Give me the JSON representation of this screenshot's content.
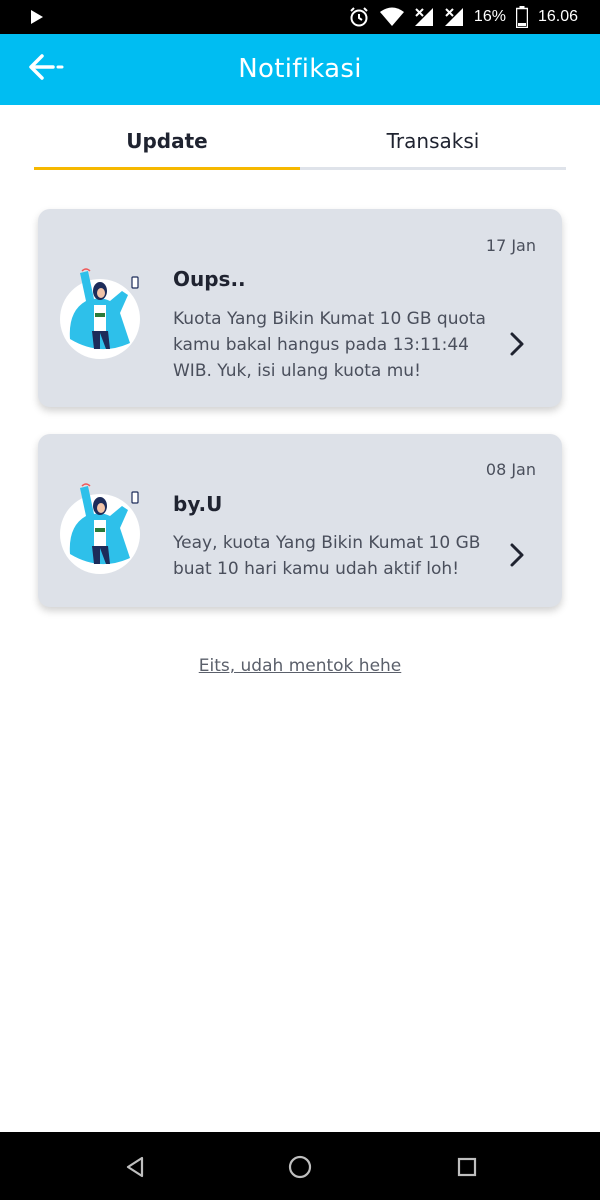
{
  "status_bar": {
    "battery_text": "16%",
    "time": "16.06",
    "icons": [
      "play-icon",
      "alarm-icon",
      "wifi-icon",
      "signal-icon",
      "signal-icon",
      "battery-icon"
    ]
  },
  "app_bar": {
    "title": "Notifikasi",
    "back_icon": "arrow-left-icon",
    "background": "#00bdf2"
  },
  "tabs": [
    {
      "label": "Update",
      "active": true,
      "accent": "#f6b800"
    },
    {
      "label": "Transaksi",
      "active": false
    }
  ],
  "notifications": [
    {
      "date": "17 Jan",
      "title": "Oups..",
      "body": "Kuota Yang Bikin Kumat 10 GB quota kamu bakal hangus pada 13:11:44 WIB. Yuk, isi ulang kuota mu!",
      "icon": "character-illustration"
    },
    {
      "date": "08 Jan",
      "title": "by.U",
      "body": "Yeay, kuota Yang Bikin Kumat 10 GB buat 10 hari kamu udah aktif loh!",
      "icon": "character-illustration"
    }
  ],
  "end_message": "Eits, udah mentok hehe",
  "nav_bar": {
    "icons": [
      "back-triangle-icon",
      "home-circle-icon",
      "recents-square-icon"
    ]
  }
}
